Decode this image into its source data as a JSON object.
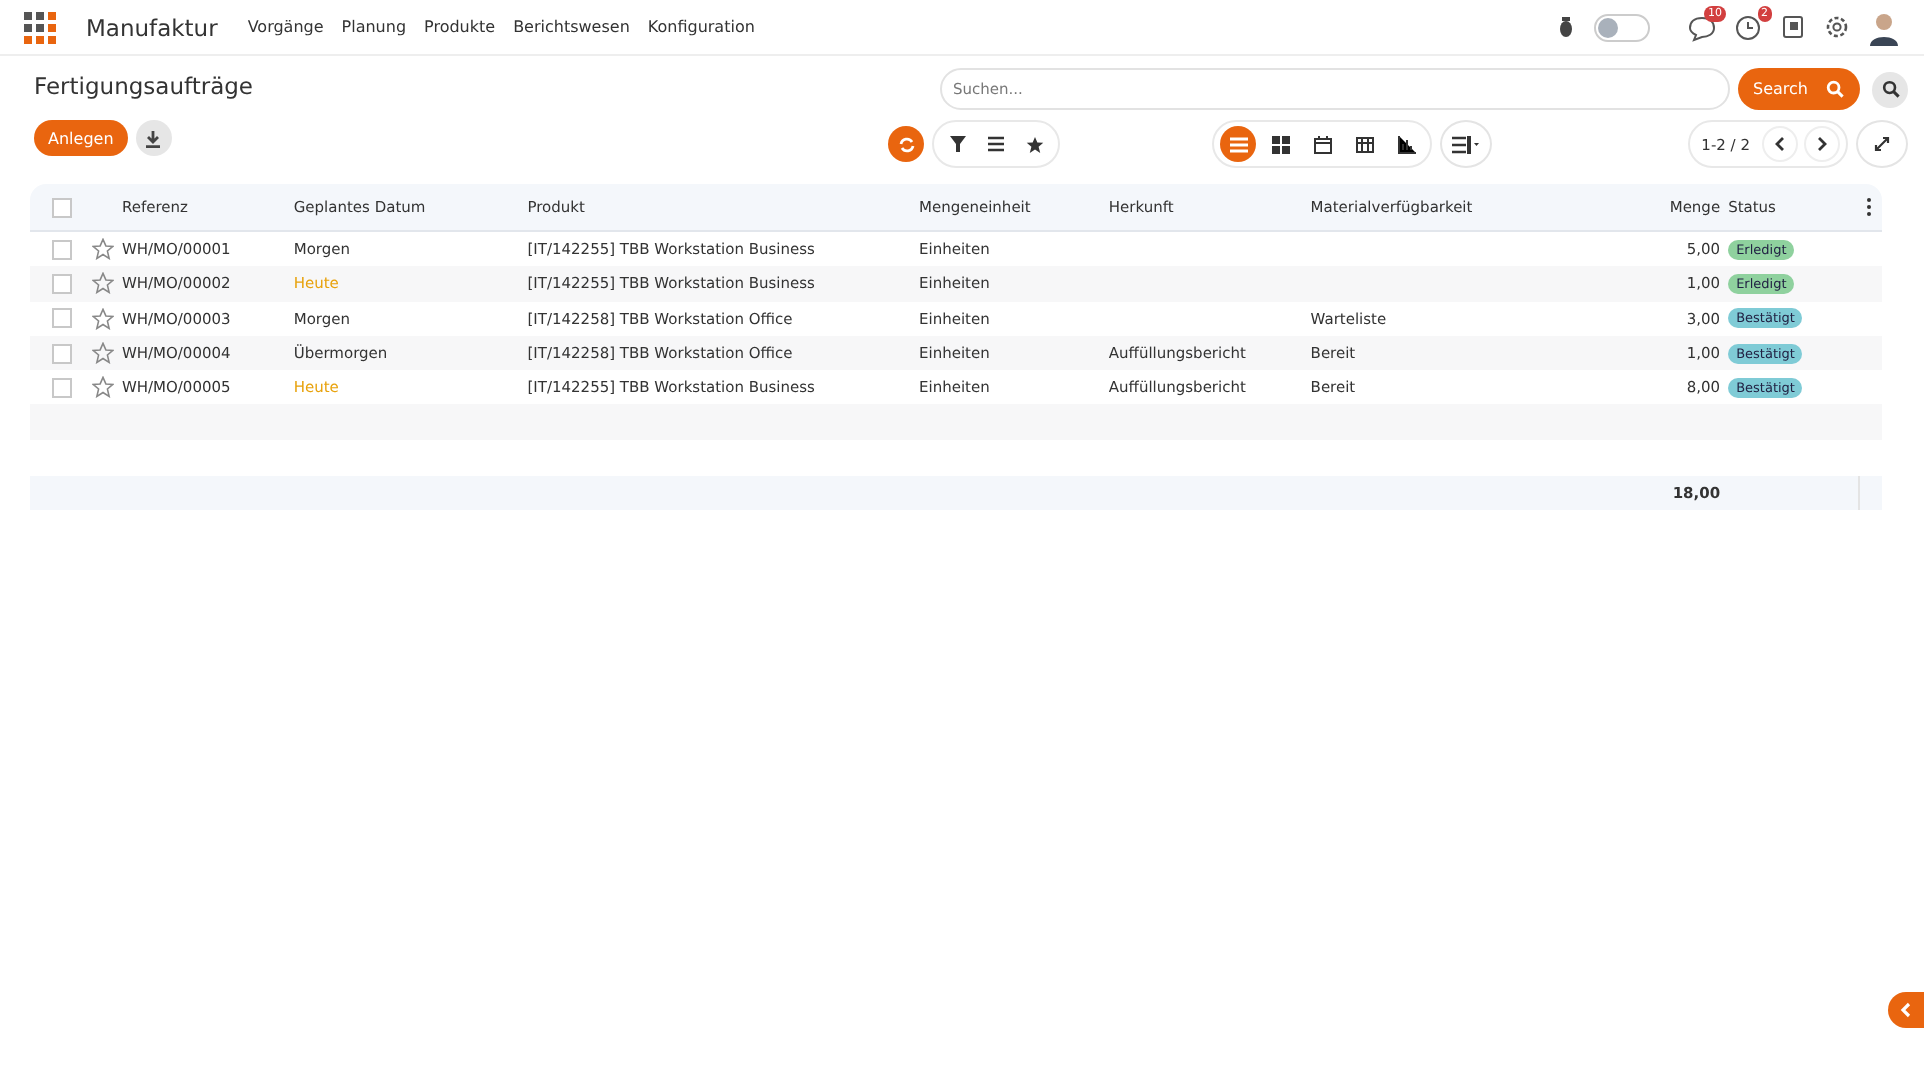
{
  "navbar": {
    "app_name": "Manufaktur",
    "menu": [
      "Vorgänge",
      "Planung",
      "Produkte",
      "Berichtswesen",
      "Konfiguration"
    ],
    "debug_toggle": {
      "on": false
    },
    "messages_count": "10",
    "activities_count": "2"
  },
  "title": "Fertigungsaufträge",
  "create_button": "Anlegen",
  "search": {
    "placeholder": "Suchen...",
    "button": "Search"
  },
  "view_switcher": [
    {
      "kind": "list",
      "selected": true
    },
    {
      "kind": "kanban",
      "selected": false
    },
    {
      "kind": "calendar",
      "selected": false
    },
    {
      "kind": "pivot",
      "selected": false
    },
    {
      "kind": "graph",
      "selected": false
    }
  ],
  "pager": "1-2 / 2",
  "table": {
    "all_selected": false,
    "columns": [
      "Referenz",
      "Geplantes Datum",
      "Produkt",
      "Mengeneinheit",
      "Herkunft",
      "Materialverfügbarkeit",
      "Menge",
      "Status"
    ],
    "rows": [
      {
        "checked": false,
        "starred": false,
        "reference": "WH/MO/00001",
        "date": "Morgen",
        "date_today": false,
        "product": "[IT/142255] TBB Workstation Business",
        "uom": "Einheiten",
        "quantity": "5,00",
        "status": {
          "label": "Erledigt",
          "color": "#8fd19e"
        }
      },
      {
        "checked": false,
        "starred": false,
        "reference": "WH/MO/00002",
        "date": "Heute",
        "date_today": true,
        "product": "[IT/142255] TBB Workstation Business",
        "uom": "Einheiten",
        "quantity": "1,00",
        "status": {
          "label": "Erledigt",
          "color": "#8fd19e"
        }
      },
      {
        "checked": false,
        "starred": false,
        "reference": "WH/MO/00003",
        "date": "Morgen",
        "date_today": false,
        "product": "[IT/142258] TBB Workstation Office",
        "uom": "Einheiten",
        "availability": "Warteliste",
        "quantity": "3,00",
        "status": {
          "label": "Bestätigt",
          "color": "#7fcbd6"
        }
      },
      {
        "checked": false,
        "starred": false,
        "reference": "WH/MO/00004",
        "date": "Übermorgen",
        "date_today": false,
        "product": "[IT/142258] TBB Workstation Office",
        "uom": "Einheiten",
        "origin": "Auffüllungsbericht",
        "availability": "Bereit",
        "quantity": "1,00",
        "status": {
          "label": "Bestätigt",
          "color": "#7fcbd6"
        }
      },
      {
        "checked": false,
        "starred": false,
        "reference": "WH/MO/00005",
        "date": "Heute",
        "date_today": true,
        "product": "[IT/142255] TBB Workstation Business",
        "uom": "Einheiten",
        "origin": "Auffüllungsbericht",
        "availability": "Bereit",
        "quantity": "8,00",
        "status": {
          "label": "Bestätigt",
          "color": "#7fcbd6"
        }
      }
    ],
    "total_quantity": "18,00"
  }
}
